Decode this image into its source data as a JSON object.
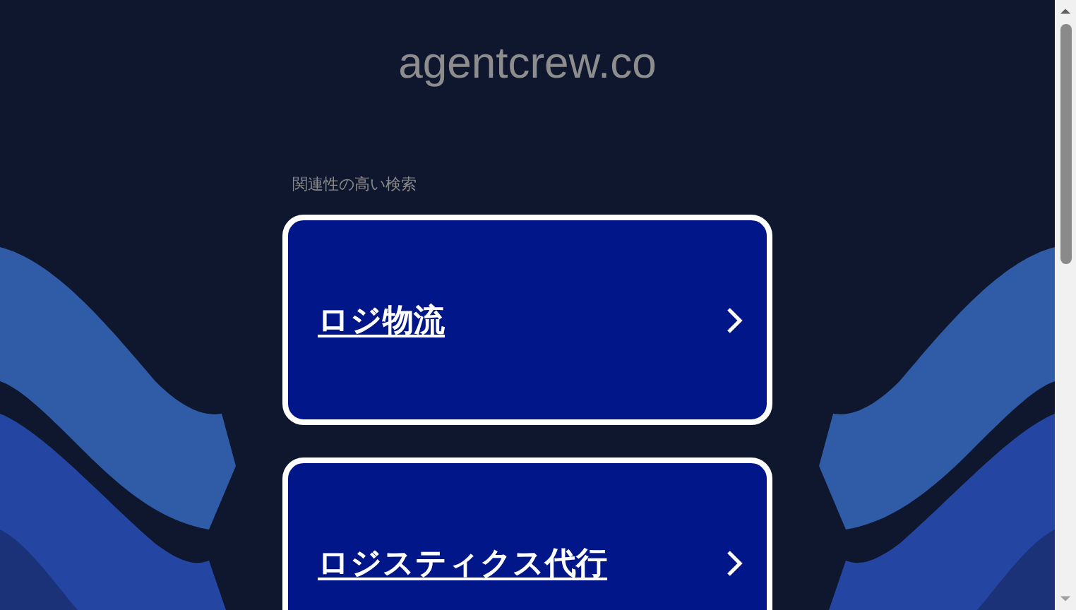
{
  "site_title": "agentcrew.co",
  "related_searches": {
    "heading": "関連性の高い検索",
    "items": [
      {
        "label": "ロジ物流"
      },
      {
        "label": "ロジスティクス代行"
      }
    ]
  }
}
